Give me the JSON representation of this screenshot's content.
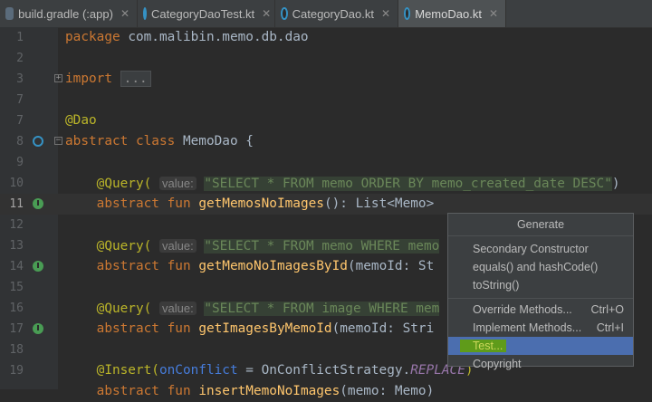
{
  "tabs": [
    {
      "label": "build.gradle (:app)",
      "icon": "gradle-file-icon"
    },
    {
      "label": "CategoryDaoTest.kt",
      "icon": "kotlin-file-icon"
    },
    {
      "label": "CategoryDao.kt",
      "icon": "kotlin-file-icon"
    },
    {
      "label": "MemoDao.kt",
      "icon": "kotlin-file-icon",
      "active": true
    }
  ],
  "tab_close": "✕",
  "lines": {
    "n1": "1",
    "n2": "2",
    "n3": "3",
    "n7": "7",
    "n8": "8",
    "n9": "9",
    "n10": "10",
    "n11": "11",
    "n12": "12",
    "n13": "13",
    "n14": "14",
    "n15": "15",
    "n16": "16",
    "n17": "17",
    "n18": "18",
    "n19": "19"
  },
  "code": {
    "package_kw": "package",
    "package_name": " com.malibin.memo.db.dao",
    "import_kw": "import",
    "import_dots": "...",
    "dao_ann": "@Dao",
    "abstract_kw": "abstract",
    "class_kw": "class",
    "class_name": " MemoDao {",
    "query_ann": "@Query(",
    "value_hint": "value:",
    "q1_str": "\"SELECT * FROM memo ORDER BY memo_created_date DESC\"",
    "q2_str": "\"SELECT * FROM memo WHERE memo",
    "q3_str": "\"SELECT * FROM image WHERE mem",
    "close_paren": ")",
    "fun_kw": "fun",
    "fn1": "getMemosNoImages",
    "fn1_sig": "(): List<Memo>",
    "fn2": "getMemoNoImagesById",
    "fn2_sig": "(memoId: St",
    "fn3": "getImagesByMemoId",
    "fn3_sig": "(memoId: Stri",
    "insert_ann": "@Insert(",
    "on_conflict": "onConflict",
    "eq": " = OnConflictStrategy.",
    "replace": "REPLACE",
    "fn4": "insertMemoNoImages",
    "fn4_sig": "(memo: Memo)"
  },
  "popup": {
    "title": "Generate",
    "items": [
      {
        "label": "Secondary Constructor",
        "shortcut": ""
      },
      {
        "label": "equals() and hashCode()",
        "shortcut": ""
      },
      {
        "label": "toString()",
        "shortcut": ""
      },
      {
        "label": "Override Methods...",
        "shortcut": "Ctrl+O"
      },
      {
        "label": "Implement Methods...",
        "shortcut": "Ctrl+I"
      },
      {
        "label": "Test...",
        "shortcut": "",
        "selected": true
      },
      {
        "label": "Copyright",
        "shortcut": ""
      }
    ]
  }
}
